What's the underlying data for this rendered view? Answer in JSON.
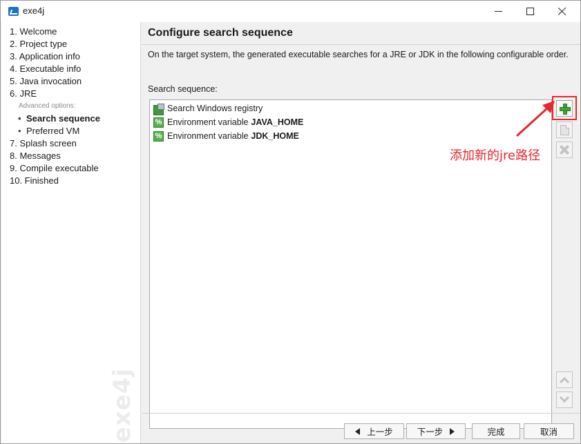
{
  "window": {
    "title": "exe4j"
  },
  "nav": {
    "items": [
      {
        "label": "1. Welcome"
      },
      {
        "label": "2. Project type"
      },
      {
        "label": "3. Application info"
      },
      {
        "label": "4. Executable info"
      },
      {
        "label": "5. Java invocation"
      },
      {
        "label": "6. JRE"
      }
    ],
    "advanced_label": "Advanced options:",
    "sub_items": [
      {
        "bullet": "•",
        "label": "Search sequence",
        "active": true
      },
      {
        "bullet": "•",
        "label": "Preferred VM",
        "active": false
      }
    ],
    "items_after": [
      {
        "label": "7. Splash screen"
      },
      {
        "label": "8. Messages"
      },
      {
        "label": "9. Compile executable"
      },
      {
        "label": "10. Finished"
      }
    ],
    "watermark": "exe4j"
  },
  "page": {
    "title": "Configure search sequence",
    "description": "On the target system, the generated executable searches for a JRE or JDK in the following configurable order.",
    "sequence_label": "Search sequence:"
  },
  "sequence": [
    {
      "icon": "registry-icon",
      "prefix": "Search Windows registry",
      "name": ""
    },
    {
      "icon": "env-variable-icon",
      "prefix": "Environment variable",
      "name": "JAVA_HOME"
    },
    {
      "icon": "env-variable-icon",
      "prefix": "Environment variable",
      "name": "JDK_HOME"
    }
  ],
  "annotation": {
    "text": "添加新的jre路径",
    "color": "#e8262b"
  },
  "footer": {
    "back_label": "上一步",
    "next_label": "下一步",
    "finish_label": "完成",
    "cancel_label": "取消"
  },
  "colors": {
    "accent_green": "#3fa636",
    "highlight_red": "#e8262b"
  }
}
